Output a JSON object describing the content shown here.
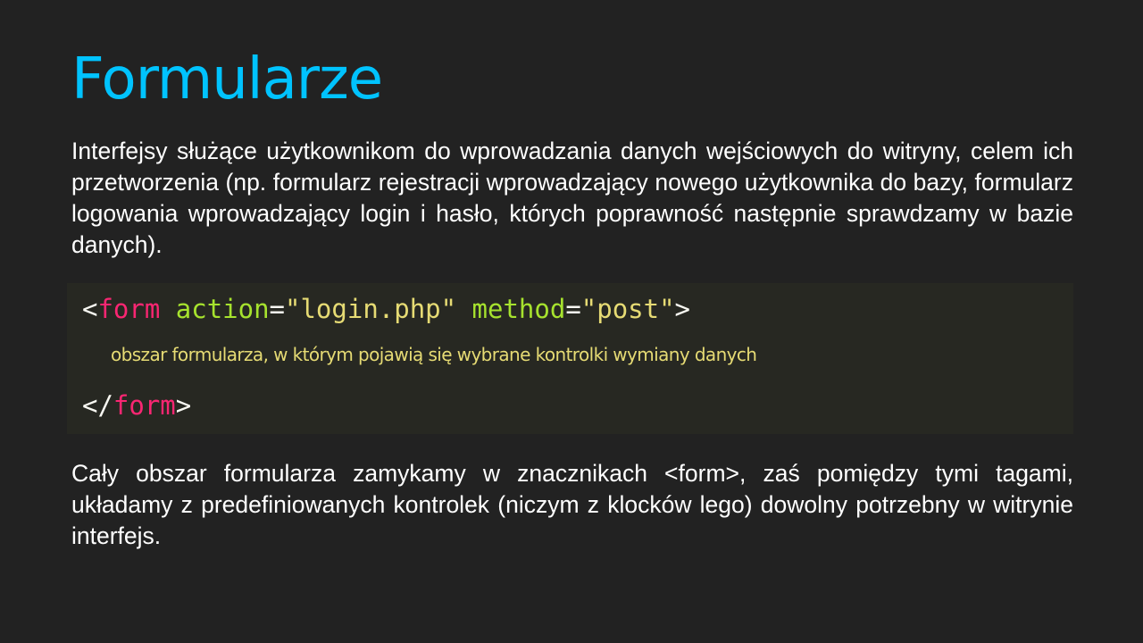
{
  "title": "Formularze",
  "intro": "Interfejsy służące użytkownikom do wprowadzania danych wejściowych do witryny, celem ich przetworzenia (np. formularz rejestracji wprowadzający nowego użytkownika do bazy, formularz logowania wprowadzający login i hasło, których poprawność następnie sprawdzamy w bazie danych).",
  "code": {
    "open_bracket": "<",
    "tag": "form",
    "attr1": "action",
    "eq": "=",
    "val1": "\"login.php\"",
    "attr2": "method",
    "val2": "\"post\"",
    "close_bracket": ">",
    "comment": "obszar formularza, w którym pojawią się wybrane kontrolki wymiany danych",
    "end_open": "</",
    "end_tag": "form",
    "end_close": ">"
  },
  "outro": "Cały obszar formularza zamykamy w znacznikach <form>, zaś pomiędzy tymi tagami, układamy z predefiniowanych kontrolek (niczym z klocków lego) dowolny potrzebny w witrynie interfejs.",
  "colors": {
    "title": "#00c3ff",
    "background": "#222222",
    "code_bg": "#272822",
    "tag": "#f92672",
    "attribute": "#a6e22e",
    "string": "#e6db74"
  }
}
